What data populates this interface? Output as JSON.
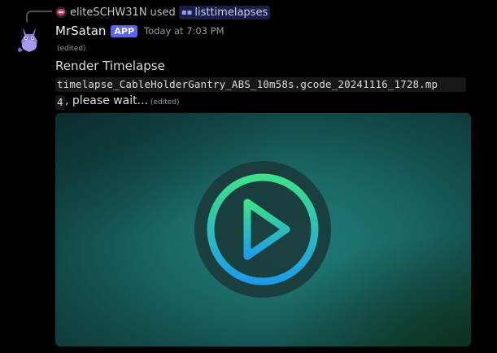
{
  "reply": {
    "username": "eliteSCHW31N",
    "used_text": "used",
    "command": "listtimelapses"
  },
  "message": {
    "author": "MrSatan",
    "badge": "APP",
    "timestamp": "Today at 7:03 PM",
    "edited_label": "(edited)",
    "line1": "Render Timelapse",
    "filename_part1": "timelapse_CableHolderGantry_ABS_10m58s.gcode_20241116_1728.mp",
    "filename_part2": "4",
    "suffix_text": ", please wait...",
    "edited_inline": "(edited)"
  },
  "video": {
    "play_icon": "play-icon"
  },
  "colors": {
    "background": "#000000",
    "accent": "#5865f2",
    "play_gradient_top": "#3ee08a",
    "play_gradient_bottom": "#1e9be8"
  }
}
